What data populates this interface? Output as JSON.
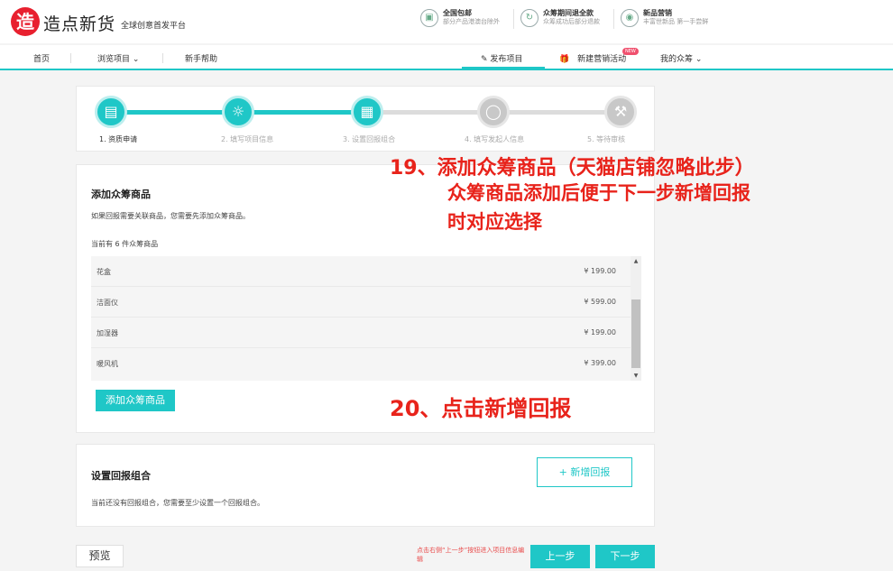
{
  "header": {
    "logo_char": "造",
    "brand": "造点新货",
    "slogan": "全球创意首发平台",
    "promos": [
      {
        "icon": "gift-box-icon",
        "title": "全国包邮",
        "sub": "部分产品港澳台除外"
      },
      {
        "icon": "refund-icon",
        "title": "众筹期间退全款",
        "sub": "众筹成功后部分退款"
      },
      {
        "icon": "broadcast-icon",
        "title": "新品营销",
        "sub": "丰富世新品 第一手尝鲜"
      }
    ]
  },
  "nav": {
    "home": "首页",
    "browse": "浏览项目",
    "help": "新手帮助",
    "publish": "发布项目",
    "marketing": "新建营销活动",
    "new_badge": "NEW",
    "my": "我的众筹"
  },
  "steps": [
    {
      "label": "1. 资质申请",
      "state": "done",
      "icon": "document-icon"
    },
    {
      "label": "2. 填写项目信息",
      "state": "done",
      "icon": "lightbulb-icon"
    },
    {
      "label": "3. 设置回报组合",
      "state": "done",
      "icon": "gift-icon"
    },
    {
      "label": "4. 填写发起人信息",
      "state": "todo",
      "icon": "person-icon"
    },
    {
      "label": "5. 等待审核",
      "state": "todo",
      "icon": "gavel-icon"
    }
  ],
  "products": {
    "title": "添加众筹商品",
    "note": "如果回报需要关联商品，您需要先添加众筹商品。",
    "count_text": "当前有 6 件众筹商品",
    "items": [
      {
        "name": "花盒",
        "price": "¥ 199.00"
      },
      {
        "name": "洁面仪",
        "price": "¥ 599.00"
      },
      {
        "name": "加湿器",
        "price": "¥ 199.00"
      },
      {
        "name": "暖风机",
        "price": "¥ 399.00"
      }
    ],
    "add_button": "添加众筹商品"
  },
  "reward": {
    "title": "设置回报组合",
    "note": "当前还没有回报组合，您需要至少设置一个回报组合。",
    "add_button": "+    新增回报"
  },
  "footer": {
    "preview": "预览",
    "hint": "点击右侧“上一步”按钮进入项目信息编辑",
    "prev": "上一步",
    "next": "下一步"
  },
  "annotations": {
    "a19_line1": "19、添加众筹商品（天猫店铺忽略此步）",
    "a19_line2": "众筹商品添加后便于下一步新增回报",
    "a19_line3": "时对应选择",
    "a20": "20、点击新增回报"
  },
  "colors": {
    "accent": "#1fc7c7",
    "brand": "#e8202f",
    "annotation": "#e8231b"
  }
}
